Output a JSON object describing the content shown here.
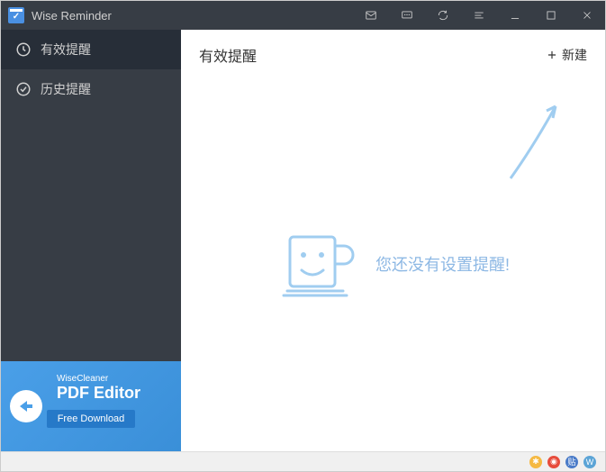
{
  "app": {
    "title": "Wise Reminder"
  },
  "sidebar": {
    "items": [
      {
        "label": "有效提醒"
      },
      {
        "label": "历史提醒"
      }
    ]
  },
  "promo": {
    "brand": "WiseCleaner",
    "title": "PDF Editor",
    "button": "Free Download"
  },
  "main": {
    "title": "有效提醒",
    "new_button": "新建",
    "empty_text": "您还没有设置提醒!"
  }
}
